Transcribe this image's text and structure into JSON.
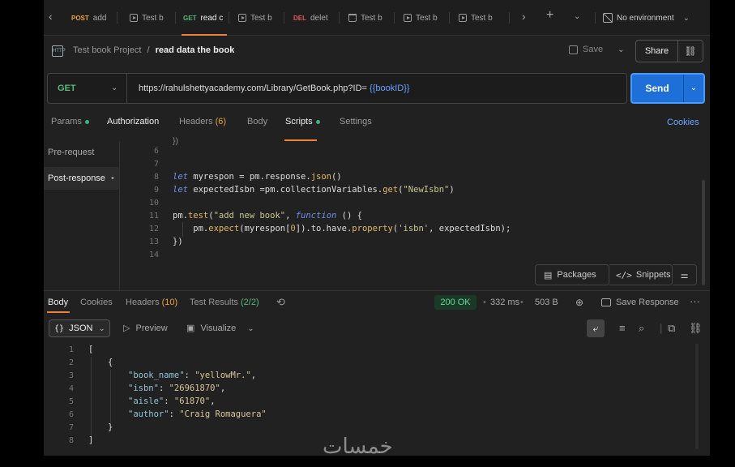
{
  "tabs": [
    {
      "method": "POST",
      "label": "add",
      "method_color": "#e8a33a"
    },
    {
      "method": "",
      "label": "Test b",
      "method_color": ""
    },
    {
      "method": "GET",
      "label": "read c",
      "method_color": "#58b87a"
    },
    {
      "method": "",
      "label": "Test b",
      "method_color": ""
    },
    {
      "method": "DEL",
      "label": "delet",
      "method_color": "#e05a5a"
    },
    {
      "method": "",
      "label": "Test b",
      "method_color": ""
    },
    {
      "method": "",
      "label": "Test b",
      "method_color": ""
    },
    {
      "method": "",
      "label": "Test b",
      "method_color": ""
    }
  ],
  "environment": "No environment",
  "breadcrumb": {
    "project": "Test book Project",
    "separator": "/",
    "current": "read data the book",
    "icon_text": "HTTP"
  },
  "header": {
    "save_label": "Save",
    "share_label": "Share"
  },
  "request": {
    "method": "GET",
    "url_prefix": "https://rahulshettyacademy.com/Library/GetBook.php?ID= ",
    "url_var": "{{bookID}}",
    "send_label": "Send"
  },
  "request_tabs": {
    "params": "Params",
    "authorization": "Authorization",
    "headers": "Headers",
    "headers_count": "(6)",
    "body": "Body",
    "scripts": "Scripts",
    "settings": "Settings",
    "cookies": "Cookies"
  },
  "script_side": {
    "pre_request": "Pre-request",
    "post_response": "Post-response",
    "post_dot": "•"
  },
  "editor": {
    "line_numbers": [
      "6",
      "7",
      "8",
      "9",
      "10",
      "11",
      "12",
      "13",
      "14"
    ],
    "packages": "Packages",
    "snippets": "Snippets"
  },
  "response": {
    "tabs": {
      "body": "Body",
      "cookies": "Cookies",
      "headers": "Headers",
      "headers_count": "(10)",
      "tests": "Test Results",
      "tests_count": "(2/2)"
    },
    "status": "200 OK",
    "time": "332 ms",
    "size": "503 B",
    "save_response": "Save Response",
    "format": "JSON",
    "preview": "Preview",
    "visualize": "Visualize",
    "line_numbers": [
      "1",
      "2",
      "3",
      "4",
      "5",
      "6",
      "7",
      "8"
    ],
    "json": {
      "book_name": "yellowMr.",
      "isbn": "26961870",
      "aisle": "61870",
      "author": "Craig Romaguera"
    }
  },
  "watermark": "خمسات",
  "colors": {
    "accent": "#f0803c",
    "send": "#1f6fd8",
    "get": "#58b87a",
    "status_ok": "#6ad89a"
  }
}
